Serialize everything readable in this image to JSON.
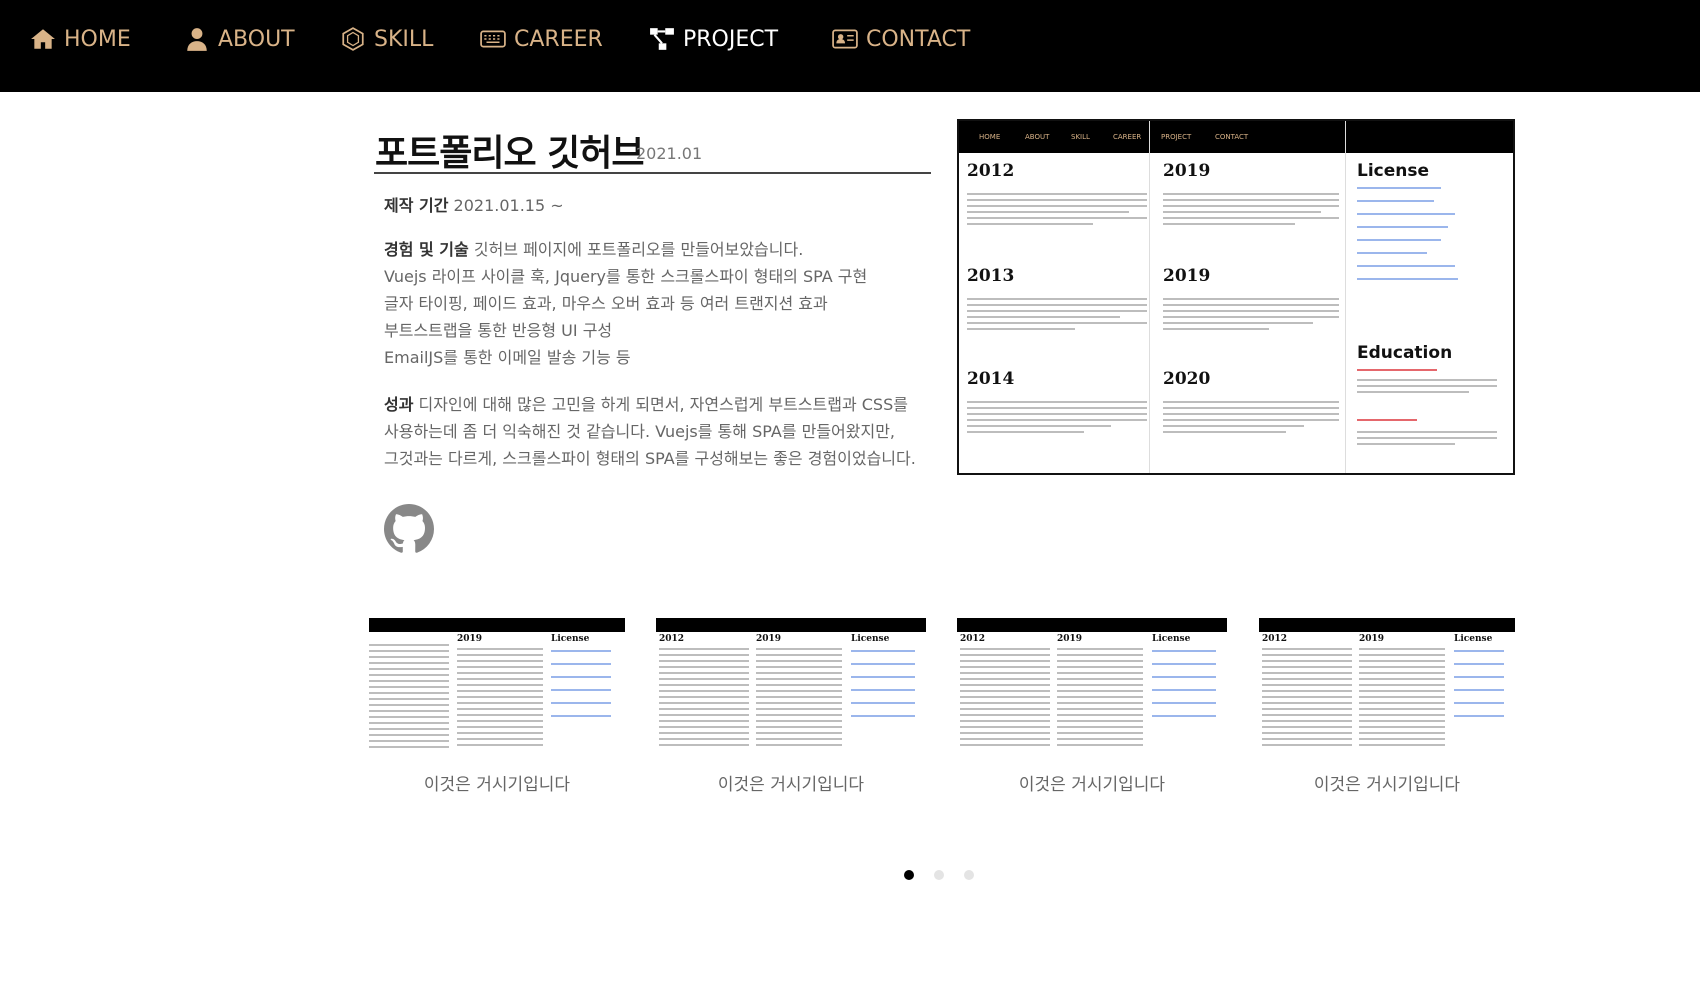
{
  "nav": {
    "items": [
      {
        "label": "HOME",
        "icon": "home-icon"
      },
      {
        "label": "ABOUT",
        "icon": "user-icon"
      },
      {
        "label": "SKILL",
        "icon": "hexagon-icon"
      },
      {
        "label": "CAREER",
        "icon": "keyboard-icon"
      },
      {
        "label": "PROJECT",
        "icon": "sitemap-icon"
      },
      {
        "label": "CONTACT",
        "icon": "address-card-icon"
      }
    ],
    "active": "PROJECT",
    "accent_color": "#d9b388"
  },
  "project": {
    "title": "포트폴리오 깃허브",
    "year": "2021.01",
    "period_label": "제작 기간",
    "period_value": "2021.01.15 ~",
    "exp_label": "경험 및 기술",
    "exp_first": "깃허브 페이지에 포트폴리오를 만들어보았습니다.",
    "exp_lines": [
      "Vuejs 라이프 사이클 훅, Jquery를 통한 스크롤스파이 형태의 SPA 구현",
      "글자 타이핑, 페이드 효과, 마우스 오버 효과 등 여러 트랜지션 효과",
      "부트스트랩을 통한 반응형 UI 구성",
      "EmailJS를 통한 이메일 발송 기능 등"
    ],
    "result_label": "성과",
    "result_first": "디자인에 대해 많은 고민을 하게 되면서, 자연스럽게 부트스트랩과 CSS를",
    "result_lines": [
      "사용하는데 좀 더 익숙해진 것 같습니다. Vuejs를 통해 SPA를 만들어왔지만,",
      "그것과는 다르게, 스크롤스파이 형태의 SPA를 구성해보는 좋은 경험이었습니다."
    ],
    "github_icon": "github-icon"
  },
  "preview": {
    "nav": [
      "HOME",
      "ABOUT",
      "SKILL",
      "CAREER",
      "PROJECT",
      "CONTACT"
    ],
    "years_col1": [
      "2012",
      "2013",
      "2014"
    ],
    "years_col2": [
      "2019",
      "2019",
      "2020"
    ],
    "license_title": "License",
    "education_title": "Education"
  },
  "carousel": {
    "captions": [
      "이것은 거시기입니다",
      "이것은 거시기입니다",
      "이것은 거시기입니다",
      "이것은 거시기입니다"
    ],
    "dots": 3,
    "active_dot": 0
  }
}
